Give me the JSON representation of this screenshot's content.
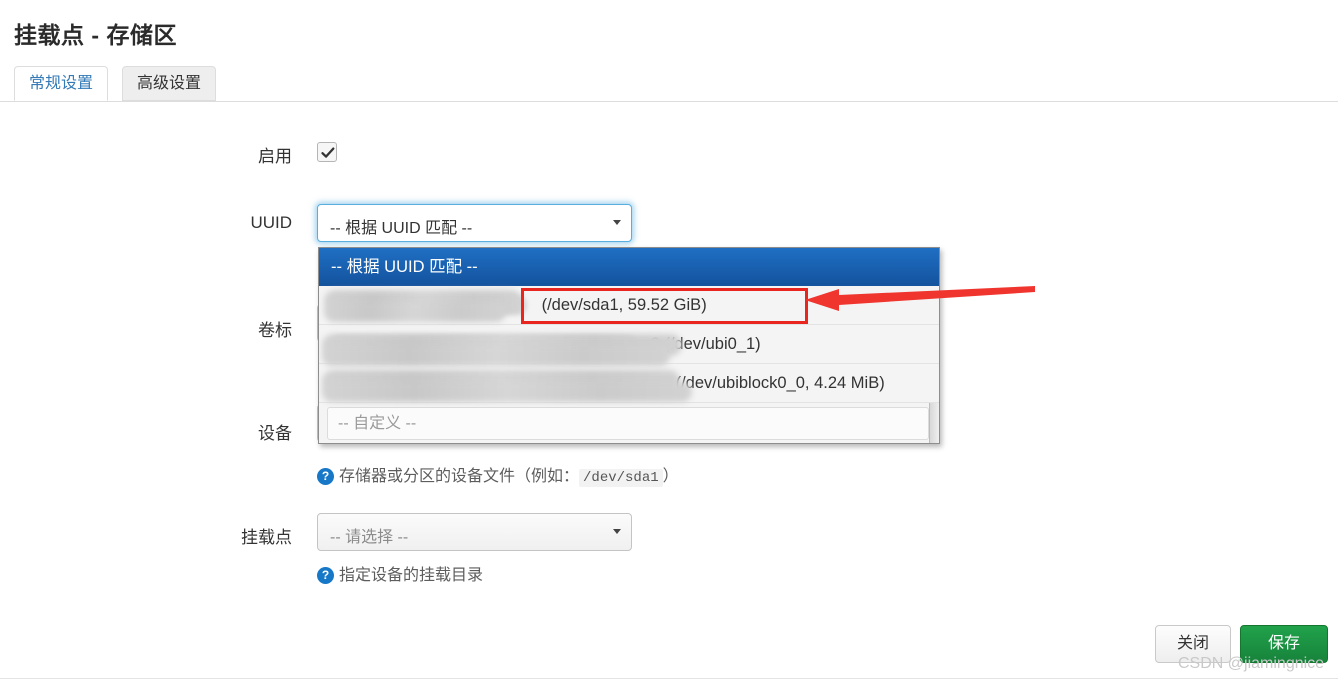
{
  "page": {
    "title": "挂载点 - 存储区"
  },
  "tabs": [
    {
      "label": "常规设置",
      "active": true
    },
    {
      "label": "高级设置",
      "active": false
    }
  ],
  "form": {
    "enable": {
      "label": "启用",
      "checked": true
    },
    "uuid": {
      "label": "UUID",
      "value": "-- 根据 UUID 匹配 --",
      "expanded": true,
      "options": [
        {
          "text": "-- 根据 UUID 匹配 --",
          "selected": true,
          "redacted": false
        },
        {
          "text": "(/dev/sda1, 59.52 GiB)",
          "selected": false,
          "redacted": true,
          "highlighted": true
        },
        {
          "text": "3 (/dev/ubi0_1)",
          "selected": false,
          "redacted": true
        },
        {
          "text": "(/dev/ubiblock0_0, 4.24 MiB)",
          "selected": false,
          "redacted": true
        },
        {
          "text": "-- 自定义 --",
          "selected": false,
          "redacted": false
        }
      ]
    },
    "volume_label": {
      "label": "卷标"
    },
    "device": {
      "label": "设备",
      "help_prefix": "存储器或分区的设备文件（例如：",
      "help_code": "/dev/sda1",
      "help_suffix": "）"
    },
    "mount_point": {
      "label": "挂载点",
      "value": "-- 请选择 --",
      "help": "指定设备的挂载目录"
    }
  },
  "footer": {
    "close_label": "关闭",
    "save_label": "保存"
  },
  "watermark": "CSDN @jiamingnice",
  "colors": {
    "accent_blue": "#337ab7",
    "selected_blue": "#14539e",
    "save_green": "#17833b",
    "annotation_red": "#e8251f",
    "focus_glow": "#5aaede"
  }
}
